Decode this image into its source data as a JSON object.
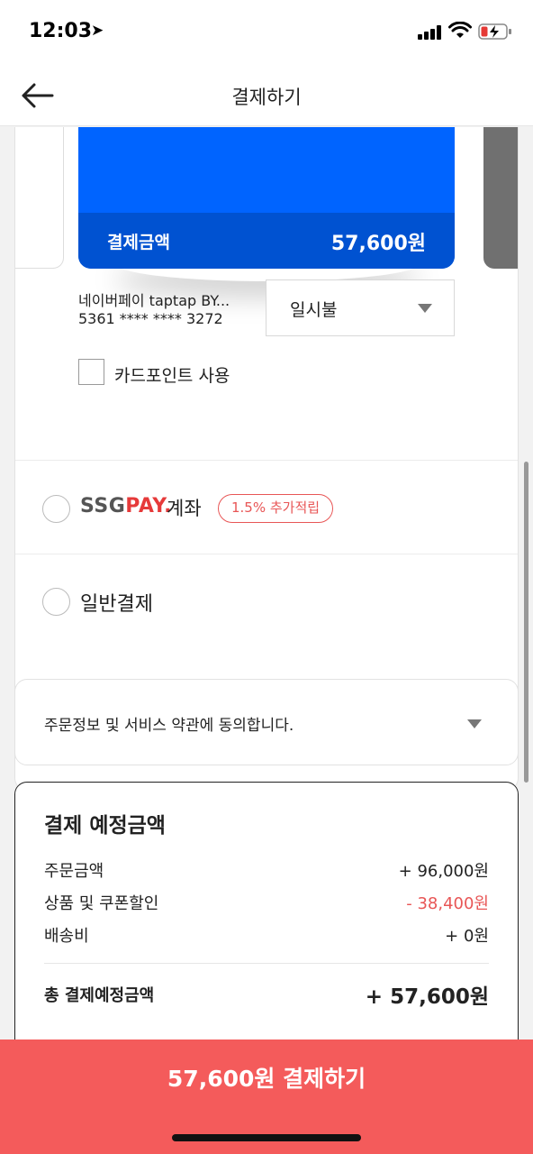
{
  "status_bar": {
    "time": "12:03"
  },
  "header": {
    "title": "결제하기"
  },
  "card": {
    "amount_label": "결제금액",
    "amount_value": "57,600원",
    "color": "#0064ff",
    "name": "네이버페이 taptap BY...",
    "number": "5361 **** **** 3272"
  },
  "installment": {
    "selected": "일시불"
  },
  "card_point": {
    "label": "카드포인트 사용",
    "checked": false
  },
  "payment_options": {
    "ssgpay": {
      "logo_ssg": "SSG",
      "logo_pay": "PAY.",
      "label": "계좌",
      "badge": "1.5% 추가적립",
      "selected": false
    },
    "general": {
      "label": "일반결제",
      "selected": false
    }
  },
  "agreement": {
    "text": "주문정보 및 서비스 약관에 동의합니다."
  },
  "summary": {
    "title": "결제 예정금액",
    "rows": [
      {
        "label": "주문금액",
        "value": "+ 96,000원"
      },
      {
        "label": "상품 및 쿠폰할인",
        "value": "- 38,400원"
      },
      {
        "label": "배송비",
        "value": "+ 0원"
      }
    ],
    "total_label": "총 결제예정금액",
    "total_value": "+ 57,600원"
  },
  "pay_button": {
    "label": "57,600원 결제하기",
    "color": "#f45b5b"
  }
}
